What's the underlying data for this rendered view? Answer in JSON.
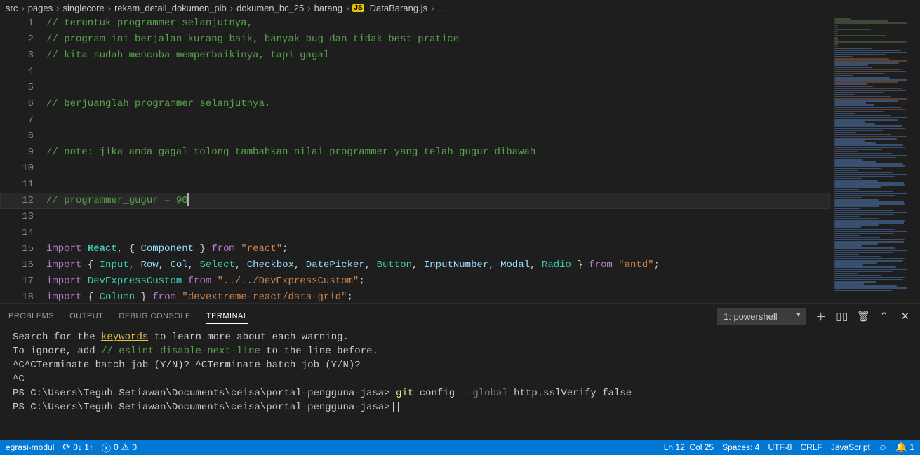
{
  "breadcrumbs": [
    "src",
    "pages",
    "singlecore",
    "rekam_detail_dokumen_pib",
    "dokumen_bc_25",
    "barang",
    "DataBarang.js",
    "..."
  ],
  "fileIcon": "JS",
  "code": {
    "lines": [
      {
        "n": 1,
        "t": "comment",
        "x": "// teruntuk programmer selanjutnya,"
      },
      {
        "n": 2,
        "t": "comment",
        "x": "// program ini berjalan kurang baik, banyak bug dan tidak best pratice"
      },
      {
        "n": 3,
        "t": "comment",
        "x": "// kita sudah mencoba memperbaikinya, tapi gagal"
      },
      {
        "n": 4,
        "t": "blank",
        "x": ""
      },
      {
        "n": 5,
        "t": "blank",
        "x": ""
      },
      {
        "n": 6,
        "t": "comment",
        "x": "// berjuanglah programmer selanjutnya."
      },
      {
        "n": 7,
        "t": "blank",
        "x": ""
      },
      {
        "n": 8,
        "t": "blank",
        "x": ""
      },
      {
        "n": 9,
        "t": "comment",
        "x": "// note: jika anda gagal tolong tambahkan nilai programmer yang telah gugur dibawah"
      },
      {
        "n": 10,
        "t": "blank",
        "x": ""
      },
      {
        "n": 11,
        "t": "blank",
        "x": ""
      },
      {
        "n": 12,
        "t": "comment",
        "x": "// programmer_gugur = 90",
        "cursor": true
      },
      {
        "n": 13,
        "t": "blank",
        "x": ""
      },
      {
        "n": 14,
        "t": "blank",
        "x": ""
      }
    ],
    "imports": {
      "l15": {
        "kw1": "import",
        "mod": "React",
        "punc1": ", { ",
        "def": "Component",
        "punc2": " } ",
        "kw2": "from",
        "str": "\"react\"",
        "end": ";"
      },
      "l16": {
        "kw1": "import",
        "punc1": " { ",
        "mods": "Input, Row, Col, Select, Checkbox, DatePicker, Button, InputNumber, Modal, Radio",
        "punc2": " } ",
        "kw2": "from",
        "str": "\"antd\"",
        "end": ";"
      },
      "l17": {
        "kw1": "import",
        "mod": "DevExpressCustom",
        "kw2": "from",
        "str": "\"../../DevExpressCustom\"",
        "end": ";"
      },
      "l18": {
        "kw1": "import",
        "punc1": " { ",
        "mod": "Column",
        "punc2": " } ",
        "kw2": "from",
        "str": "\"devextreme-react/data-grid\"",
        "end": ";"
      }
    }
  },
  "panel": {
    "tabs": [
      "PROBLEMS",
      "OUTPUT",
      "DEBUG CONSOLE",
      "TERMINAL"
    ],
    "active": 3,
    "selector": "1: powershell",
    "icons": {
      "new": "＋",
      "split": "▯▯",
      "trash": "🗑",
      "up": "⌃",
      "close": "✕"
    }
  },
  "terminal": {
    "l1a": "Search for the ",
    "l1link": "keywords",
    "l1b": " to learn more about each warning.",
    "l2a": "To ignore, add ",
    "l2eslint": "// eslint-disable-next-line",
    "l2b": " to the line before.",
    "l3": "",
    "l4": "^C^CTerminate batch job (Y/N)? ^CTerminate batch job (Y/N)?",
    "l5": "^C",
    "l6prompt": "PS C:\\Users\\Teguh Setiawan\\Documents\\ceisa\\portal-pengguna-jasa>",
    "l6git": "git",
    "l6sub": "config",
    "l6flag": "--global",
    "l6rest": "http.sslVerify false",
    "l7prompt": "PS C:\\Users\\Teguh Setiawan\\Documents\\ceisa\\portal-pengguna-jasa>"
  },
  "status": {
    "branch": "egrasi-modul",
    "sync": "0↓ 1↑",
    "errors": "0",
    "warnings": "0",
    "pos": "Ln 12, Col 25",
    "spaces": "Spaces: 4",
    "enc": "UTF-8",
    "eol": "CRLF",
    "lang": "JavaScript",
    "bell": "1"
  }
}
